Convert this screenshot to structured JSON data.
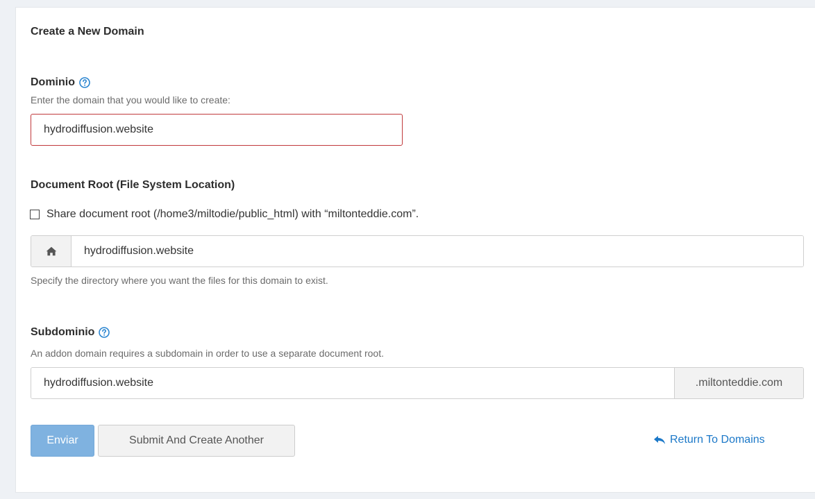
{
  "page": {
    "title": "Create a New Domain"
  },
  "domain": {
    "label": "Dominio",
    "hint": "Enter the domain that you would like to create:",
    "value": "hydrodiffusion.website"
  },
  "docroot": {
    "label": "Document Root (File System Location)",
    "share_label": "Share document root (/home3/miltodie/public_html) with “miltonteddie.com”.",
    "share_checked": false,
    "value": "hydrodiffusion.website",
    "addon_icon": "home-icon",
    "hint": "Specify the directory where you want the files for this domain to exist."
  },
  "subdomain": {
    "label": "Subdominio",
    "hint": "An addon domain requires a subdomain in order to use a separate document root.",
    "value": "hydrodiffusion.website",
    "suffix": ".miltonteddie.com"
  },
  "actions": {
    "submit_label": "Enviar",
    "submit_another_label": "Submit And Create Another",
    "return_label": "Return To Domains",
    "return_icon": "reply-arrow-icon"
  },
  "colors": {
    "primary": "#7fb2e0",
    "link": "#1b78c8",
    "error_border": "#c0393b",
    "help_icon": "#2a85d0"
  }
}
